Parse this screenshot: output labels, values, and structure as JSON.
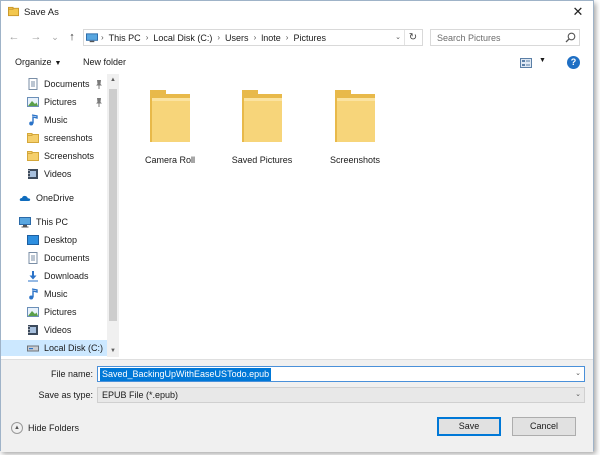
{
  "window": {
    "title": "Save As",
    "close_glyph": "✕"
  },
  "nav": {
    "back_glyph": "←",
    "forward_glyph": "→",
    "recent_glyph": "⌄",
    "up_glyph": "↑",
    "breadcrumb": [
      "This PC",
      "Local Disk (C:)",
      "Users",
      "lnote",
      "Pictures"
    ],
    "breadcrumb_separator": "›",
    "address_dropdown_glyph": "⌄",
    "refresh_glyph": "↻",
    "search_placeholder": "Search Pictures"
  },
  "toolbar": {
    "organize_label": "Organize",
    "caret_glyph": "▼",
    "new_folder_label": "New folder",
    "help_glyph": "?"
  },
  "sidebar": {
    "items": [
      {
        "label": "Documents",
        "icon": "documents-icon",
        "pinned": true
      },
      {
        "label": "Pictures",
        "icon": "pictures-icon",
        "pinned": true
      },
      {
        "label": "Music",
        "icon": "music-icon"
      },
      {
        "label": "screenshots",
        "icon": "folder-icon"
      },
      {
        "label": "Screenshots",
        "icon": "folder-icon"
      },
      {
        "label": "Videos",
        "icon": "videos-icon"
      },
      {
        "label": "OneDrive",
        "icon": "onedrive-icon"
      },
      {
        "label": "This PC",
        "icon": "computer-icon"
      },
      {
        "label": "Desktop",
        "icon": "desktop-icon"
      },
      {
        "label": "Documents",
        "icon": "documents-icon"
      },
      {
        "label": "Downloads",
        "icon": "downloads-icon"
      },
      {
        "label": "Music",
        "icon": "music-icon"
      },
      {
        "label": "Pictures",
        "icon": "pictures-icon"
      },
      {
        "label": "Videos",
        "icon": "videos-icon"
      },
      {
        "label": "Local Disk (C:)",
        "icon": "drive-icon",
        "selected": true
      }
    ],
    "scroll_up_glyph": "▲",
    "scroll_down_glyph": "▼"
  },
  "folders": [
    {
      "label": "Camera Roll"
    },
    {
      "label": "Saved Pictures"
    },
    {
      "label": "Screenshots"
    }
  ],
  "form": {
    "file_name_label": "File name:",
    "file_name_value": "Saved_BackingUpWithEaseUSTodo.epub",
    "save_as_type_label": "Save as type:",
    "save_as_type_value": "EPUB File (*.epub)",
    "dropdown_glyph": "⌄"
  },
  "footer": {
    "hide_folders_label": "Hide Folders",
    "hide_folders_glyph": "▲",
    "save_label": "Save",
    "cancel_label": "Cancel"
  },
  "colors": {
    "accent": "#0078d7",
    "folder": "#f5cf6b",
    "selection": "#cce8ff"
  }
}
